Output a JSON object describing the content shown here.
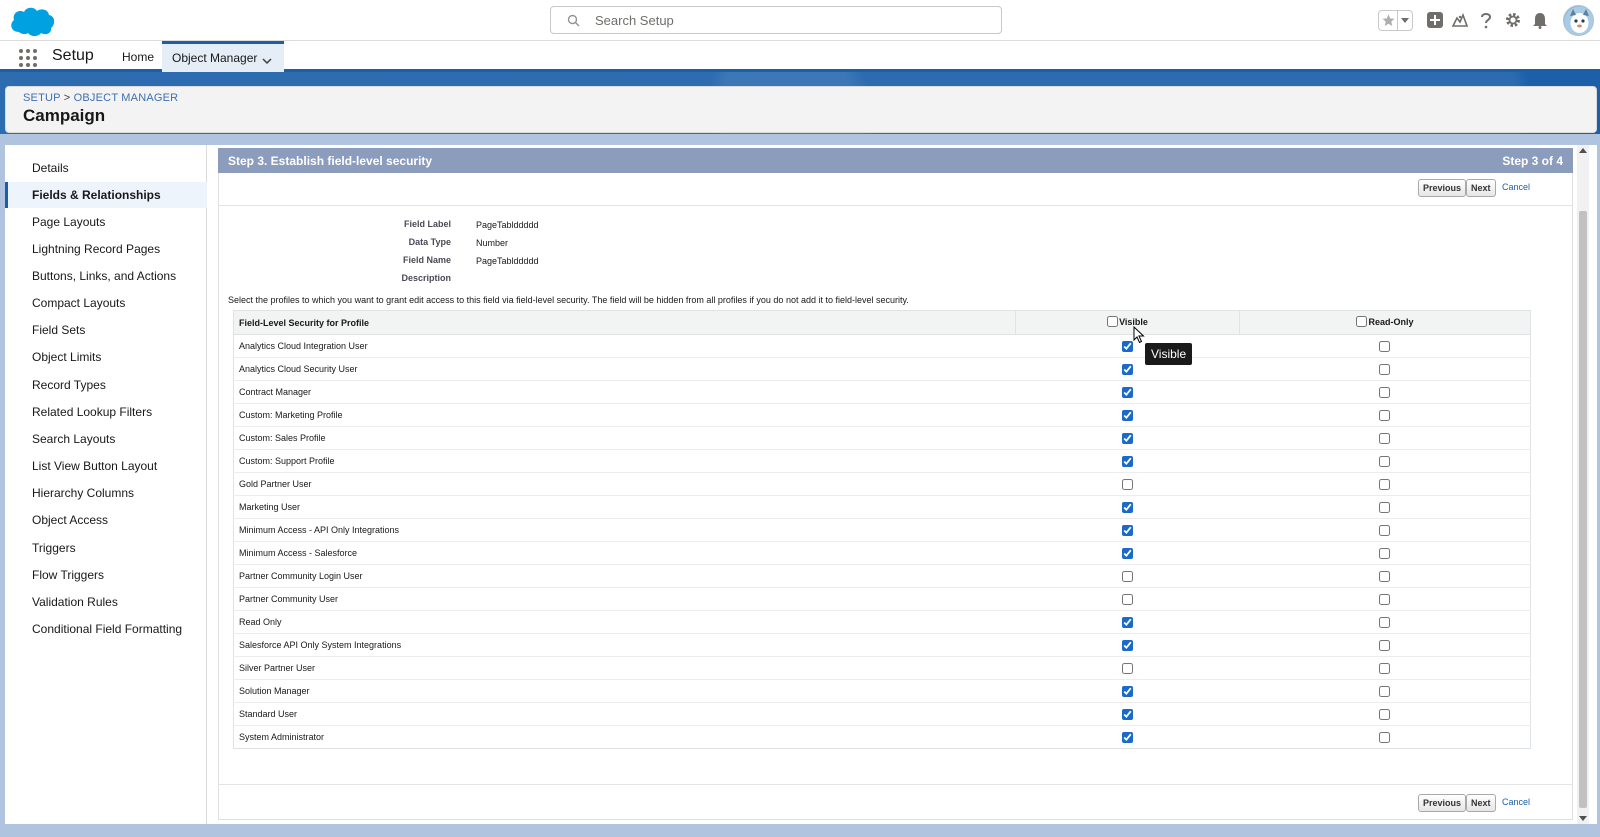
{
  "header": {
    "search": {
      "placeholder": "Search Setup"
    },
    "icons": [
      "favorites-star-icon",
      "chevron-down-icon",
      "add-icon",
      "trailhead-icon",
      "help-icon",
      "gear-icon",
      "bell-icon",
      "avatar"
    ]
  },
  "context_bar": {
    "app_name": "Setup",
    "tabs": [
      {
        "label": "Home"
      },
      {
        "label": "Object Manager"
      }
    ]
  },
  "page_header": {
    "breadcrumb": {
      "setup": "SETUP",
      "separator": ">",
      "object_manager": "OBJECT MANAGER"
    },
    "title": "Campaign"
  },
  "sidebar": {
    "items": [
      {
        "label": "Details"
      },
      {
        "label": "Fields & Relationships",
        "active": true
      },
      {
        "label": "Page Layouts"
      },
      {
        "label": "Lightning Record Pages"
      },
      {
        "label": "Buttons, Links, and Actions"
      },
      {
        "label": "Compact Layouts"
      },
      {
        "label": "Field Sets"
      },
      {
        "label": "Object Limits"
      },
      {
        "label": "Record Types"
      },
      {
        "label": "Related Lookup Filters"
      },
      {
        "label": "Search Layouts"
      },
      {
        "label": "List View Button Layout"
      },
      {
        "label": "Hierarchy Columns"
      },
      {
        "label": "Object Access"
      },
      {
        "label": "Triggers"
      },
      {
        "label": "Flow Triggers"
      },
      {
        "label": "Validation Rules"
      },
      {
        "label": "Conditional Field Formatting"
      }
    ]
  },
  "wizard": {
    "step_title": "Step 3. Establish field-level security",
    "step_count": "Step 3 of 4",
    "buttons": {
      "previous": "Previous",
      "next": "Next",
      "cancel": "Cancel"
    },
    "fields": {
      "field_label": {
        "label": "Field Label",
        "value": "PageTablddddd"
      },
      "data_type": {
        "label": "Data Type",
        "value": "Number"
      },
      "field_name": {
        "label": "Field Name",
        "value": "PageTablddddd"
      },
      "description": {
        "label": "Description",
        "value": ""
      }
    },
    "instructions": "Select the profiles to which you want to grant edit access to this field via field-level security. The field will be hidden from all profiles if you do not add it to field-level security.",
    "table": {
      "headers": {
        "profile": "Field-Level Security for Profile",
        "visible": "Visible",
        "readonly": "Read-Only"
      },
      "header_checks": {
        "visible": false,
        "readonly": false
      },
      "rows": [
        {
          "profile": "Analytics Cloud Integration User",
          "visible": true,
          "readonly": false
        },
        {
          "profile": "Analytics Cloud Security User",
          "visible": true,
          "readonly": false
        },
        {
          "profile": "Contract Manager",
          "visible": true,
          "readonly": false
        },
        {
          "profile": "Custom: Marketing Profile",
          "visible": true,
          "readonly": false
        },
        {
          "profile": "Custom: Sales Profile",
          "visible": true,
          "readonly": false
        },
        {
          "profile": "Custom: Support Profile",
          "visible": true,
          "readonly": false
        },
        {
          "profile": "Gold Partner User",
          "visible": false,
          "readonly": false
        },
        {
          "profile": "Marketing User",
          "visible": true,
          "readonly": false
        },
        {
          "profile": "Minimum Access - API Only Integrations",
          "visible": true,
          "readonly": false
        },
        {
          "profile": "Minimum Access - Salesforce",
          "visible": true,
          "readonly": false
        },
        {
          "profile": "Partner Community Login User",
          "visible": false,
          "readonly": false
        },
        {
          "profile": "Partner Community User",
          "visible": false,
          "readonly": false
        },
        {
          "profile": "Read Only",
          "visible": true,
          "readonly": false
        },
        {
          "profile": "Salesforce API Only System Integrations",
          "visible": true,
          "readonly": false
        },
        {
          "profile": "Silver Partner User",
          "visible": false,
          "readonly": false
        },
        {
          "profile": "Solution Manager",
          "visible": true,
          "readonly": false
        },
        {
          "profile": "Standard User",
          "visible": true,
          "readonly": false
        },
        {
          "profile": "System Administrator",
          "visible": true,
          "readonly": false
        }
      ]
    },
    "tooltip": "Visible"
  },
  "colors": {
    "brand_blue": "#1b5fa8",
    "step_bar": "#8b9cbd",
    "checkbox_checked": "#1b6ac9"
  }
}
